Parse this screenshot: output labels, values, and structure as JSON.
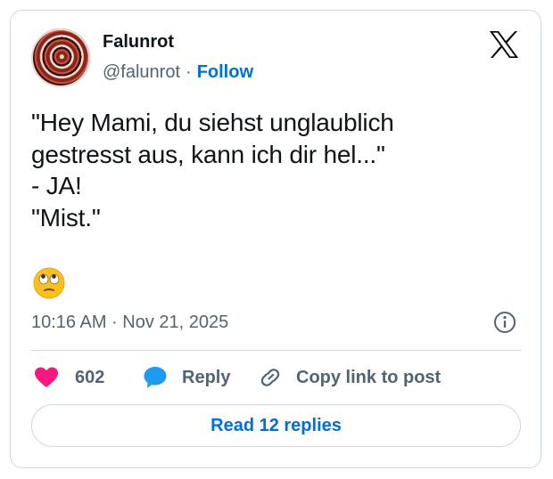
{
  "author": {
    "display_name": "Falunrot",
    "handle": "@falunrot",
    "separator": "·",
    "follow_label": "Follow"
  },
  "tweet": {
    "text": "\"Hey Mami, du siehst unglaublich\ngestresst aus, kann ich dir hel...\"\n- JA!\n\"Mist.\"",
    "emoji": "face-with-rolling-eyes",
    "timestamp": "10:16 AM · Nov 21, 2025"
  },
  "actions": {
    "like_count": "602",
    "reply_label": "Reply",
    "copy_link_label": "Copy link to post"
  },
  "read_replies_label": "Read 12 replies",
  "icons": {
    "brand": "x-logo-icon",
    "info": "info-icon",
    "like": "heart-icon",
    "reply": "speech-bubble-icon",
    "copy": "link-icon"
  },
  "colors": {
    "link_blue": "#006fd6",
    "heart": "#f91880",
    "reply_bubble": "#1d9bf0",
    "secondary_text": "#536471",
    "border": "#cfd9de"
  }
}
